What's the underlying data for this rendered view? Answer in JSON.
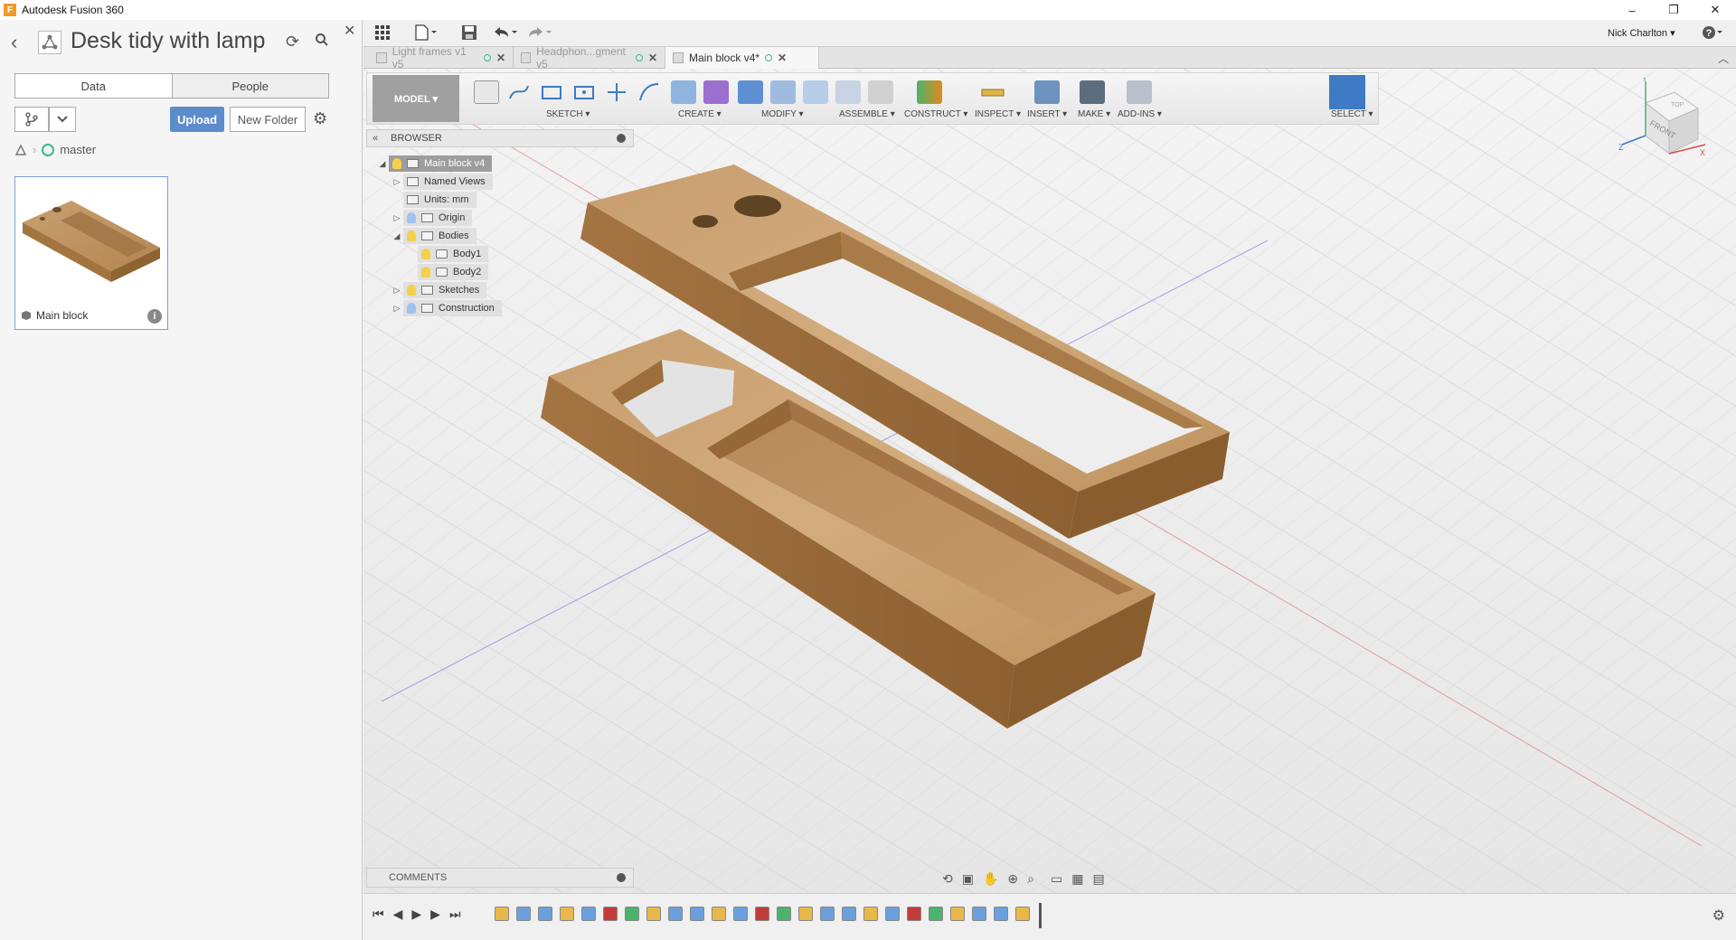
{
  "window": {
    "app_title": "Autodesk Fusion 360",
    "controls": [
      "–",
      "❐",
      "✕"
    ]
  },
  "data_panel": {
    "title": "Desk tidy with lamp",
    "tabs": [
      "Data",
      "People"
    ],
    "upload_label": "Upload",
    "new_folder_label": "New Folder",
    "branch": "master",
    "card": {
      "name": "Main block",
      "info": "i"
    }
  },
  "top_toolbar": {
    "user": "Nick Charlton ▾",
    "help": "?"
  },
  "doc_tabs": [
    {
      "label": "Light frames v1 v5",
      "active": false
    },
    {
      "label": "Headphon...gment v5",
      "active": false
    },
    {
      "label": "Main block v4*",
      "active": true
    }
  ],
  "toolbar": {
    "workspace": "MODEL ▾",
    "groups": [
      {
        "label": "SKETCH ▾"
      },
      {
        "label": "CREATE ▾"
      },
      {
        "label": "MODIFY ▾"
      },
      {
        "label": "ASSEMBLE ▾"
      },
      {
        "label": "CONSTRUCT ▾"
      },
      {
        "label": "INSPECT ▾"
      },
      {
        "label": "INSERT ▾"
      },
      {
        "label": "MAKE ▾"
      },
      {
        "label": "ADD-INS ▾"
      },
      {
        "label": "SELECT ▾"
      }
    ],
    "colors": {
      "select_accent": "#3e7bc4",
      "create_purple": "#7b4bb8",
      "construct_orange": "#e2891f"
    }
  },
  "browser": {
    "title": "BROWSER",
    "nodes": [
      {
        "label": "Main block v4",
        "expanded": true,
        "level": 0
      },
      {
        "label": "Named Views",
        "expanded": false,
        "level": 1
      },
      {
        "label": "Units: mm",
        "level": 1
      },
      {
        "label": "Origin",
        "expanded": false,
        "level": 1
      },
      {
        "label": "Bodies",
        "expanded": true,
        "level": 1
      },
      {
        "label": "Body1",
        "level": 2
      },
      {
        "label": "Body2",
        "level": 2
      },
      {
        "label": "Sketches",
        "expanded": false,
        "level": 1
      },
      {
        "label": "Construction",
        "expanded": false,
        "level": 1
      }
    ]
  },
  "comments": {
    "title": "COMMENTS"
  },
  "viewcube": {
    "face": "FRONT",
    "top": "TOP",
    "axes": [
      "Y",
      "Z",
      "X"
    ]
  },
  "timeline": {
    "item_count": 25
  }
}
